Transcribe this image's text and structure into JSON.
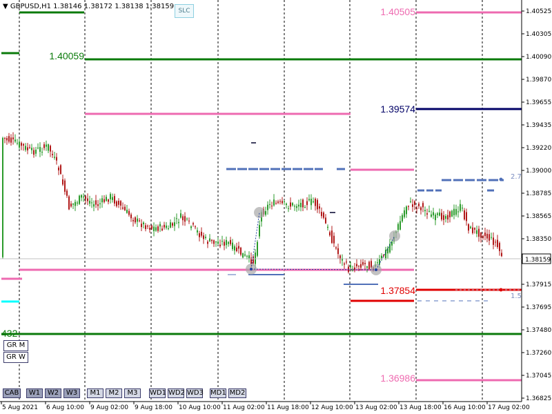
{
  "header": {
    "menu_glyph": "▼",
    "title": "GBPUSD,H1  1.38146 1.38172 1.38138 1.38159",
    "slc_label": "SLC"
  },
  "price_axis": {
    "ticks": [
      "1.40525",
      "1.40305",
      "1.40090",
      "1.39870",
      "1.39655",
      "1.39435",
      "1.39220",
      "1.39000",
      "1.38785",
      "1.38565",
      "1.38350",
      "1.38130",
      "1.37915",
      "1.37695",
      "1.37480",
      "1.37260",
      "1.37045",
      "1.36825"
    ],
    "current_price": "1.38159"
  },
  "time_axis": {
    "labels": [
      "5 Aug 2021",
      "6 Aug 10:00",
      "9 Aug 02:00",
      "9 Aug 18:00",
      "10 Aug 10:00",
      "11 Aug 02:00",
      "11 Aug 18:00",
      "12 Aug 10:00",
      "13 Aug 02:00",
      "13 Aug 18:00",
      "16 Aug 10:00",
      "17 Aug 02:00"
    ]
  },
  "level_labels": {
    "l140505": "1.40505",
    "l140059": "1.40059",
    "l139574": "1.39574",
    "l137854": "1.37854",
    "l136986": "1.36986",
    "left_432": "432",
    "ratio_27": "2.7",
    "ratio_15": "1.5"
  },
  "colors": {
    "bull": "#2a9a2a",
    "bear": "#b01818",
    "pink": "#ee6ab0",
    "green": "#0a7a0a",
    "navy": "#000066",
    "red": "#e00000",
    "blue_dash": "#5070b8",
    "cyan": "#00ffff"
  },
  "left_buttons": [
    "GR M",
    "GR W"
  ],
  "bottom_buttons": [
    "CAB",
    "W1",
    "W2",
    "W3",
    "M1",
    "M2",
    "M3",
    "WD1",
    "WD2",
    "WD3",
    "MD1",
    "MD2"
  ]
}
